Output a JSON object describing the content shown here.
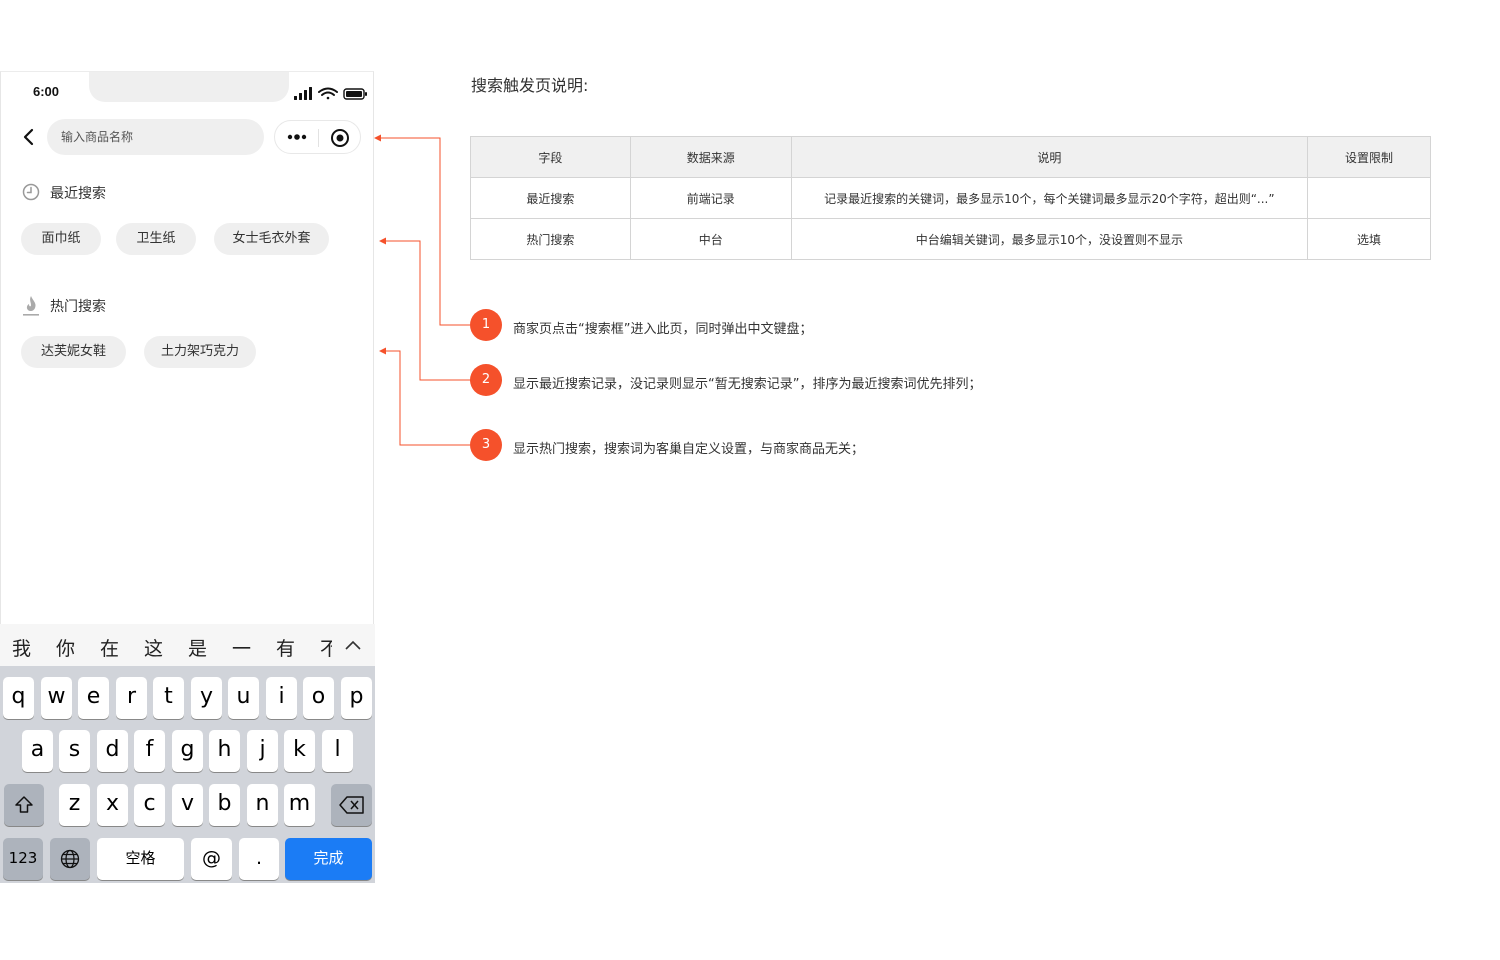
{
  "colors": {
    "accent": "#f5512b",
    "key_blue": "#1b7cf5",
    "keyboard_bg": "#d1d4da",
    "tag_bg": "#efefef"
  },
  "phone": {
    "status": {
      "time": "6:00"
    },
    "search": {
      "placeholder": "输入商品名称"
    },
    "recent": {
      "title": "最近搜索",
      "tags": [
        "面巾纸",
        "卫生纸",
        "女士毛衣外套"
      ]
    },
    "hot": {
      "title": "热门搜索",
      "tags": [
        "达芙妮女鞋",
        "土力架巧克力"
      ]
    },
    "keyboard": {
      "candidates": [
        "我",
        "你",
        "在",
        "这",
        "是",
        "一",
        "有",
        "不"
      ],
      "row1": [
        "q",
        "w",
        "e",
        "r",
        "t",
        "y",
        "u",
        "i",
        "o",
        "p"
      ],
      "row2": [
        "a",
        "s",
        "d",
        "f",
        "g",
        "h",
        "j",
        "k",
        "l"
      ],
      "row3": [
        "z",
        "x",
        "c",
        "v",
        "b",
        "n",
        "m"
      ],
      "num_label": "123",
      "space_label": "空格",
      "at_label": "@",
      "dot_label": ".",
      "done_label": "完成"
    }
  },
  "doc": {
    "title": "搜索触发页说明:",
    "table": {
      "headers": [
        "字段",
        "数据来源",
        "说明",
        "设置限制"
      ],
      "rows": [
        [
          "最近搜索",
          "前端记录",
          "记录最近搜索的关键词，最多显示10个，每个关键词最多显示20个字符，超出则“...”",
          ""
        ],
        [
          "热门搜索",
          "中台",
          "中台编辑关键词，最多显示10个，没设置则不显示",
          "选填"
        ]
      ]
    },
    "notes": [
      {
        "num": "1",
        "text": "商家页点击“搜索框”进入此页，同时弹出中文键盘；"
      },
      {
        "num": "2",
        "text": "显示最近搜索记录，没记录则显示“暂无搜索记录”，排序为最近搜索词优先排列；"
      },
      {
        "num": "3",
        "text": "显示热门搜索，搜索词为客巢自定义设置，与商家商品无关；"
      }
    ]
  }
}
